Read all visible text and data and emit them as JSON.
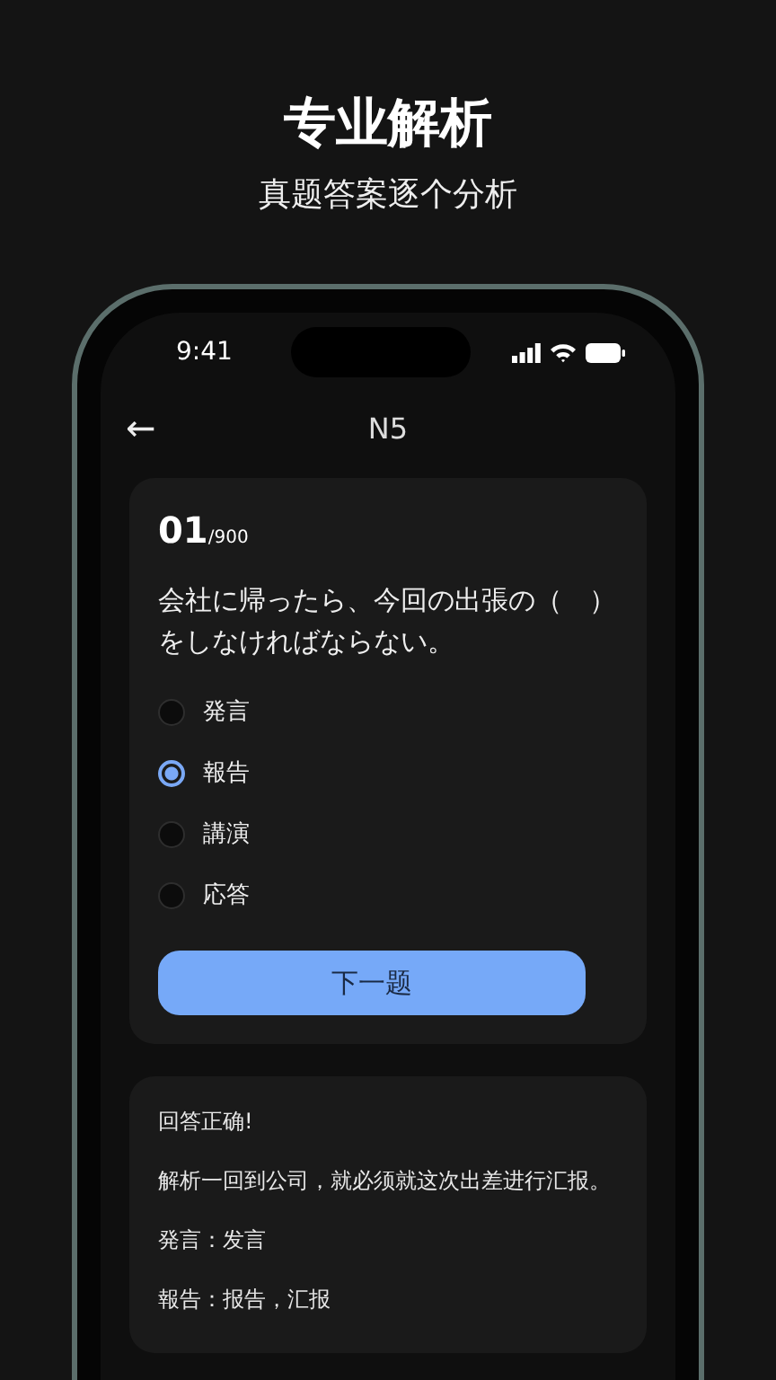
{
  "header": {
    "title": "专业解析",
    "subtitle": "真题答案逐个分析"
  },
  "status_bar": {
    "time": "9:41"
  },
  "nav": {
    "back": "←",
    "title": "N5"
  },
  "question": {
    "number": "01",
    "total": "/900",
    "text": "会社に帰ったら、今回の出張の（　）をしなければならない。",
    "options": [
      {
        "label": "発言",
        "selected": false
      },
      {
        "label": "報告",
        "selected": true
      },
      {
        "label": "講演",
        "selected": false
      },
      {
        "label": "応答",
        "selected": false
      }
    ],
    "next_button": "下一题"
  },
  "analysis": {
    "lines": [
      "回答正确!",
      "解析一回到公司，就必须就这次出差进行汇报。",
      "発言：发言",
      "報告：报告，汇报"
    ]
  }
}
